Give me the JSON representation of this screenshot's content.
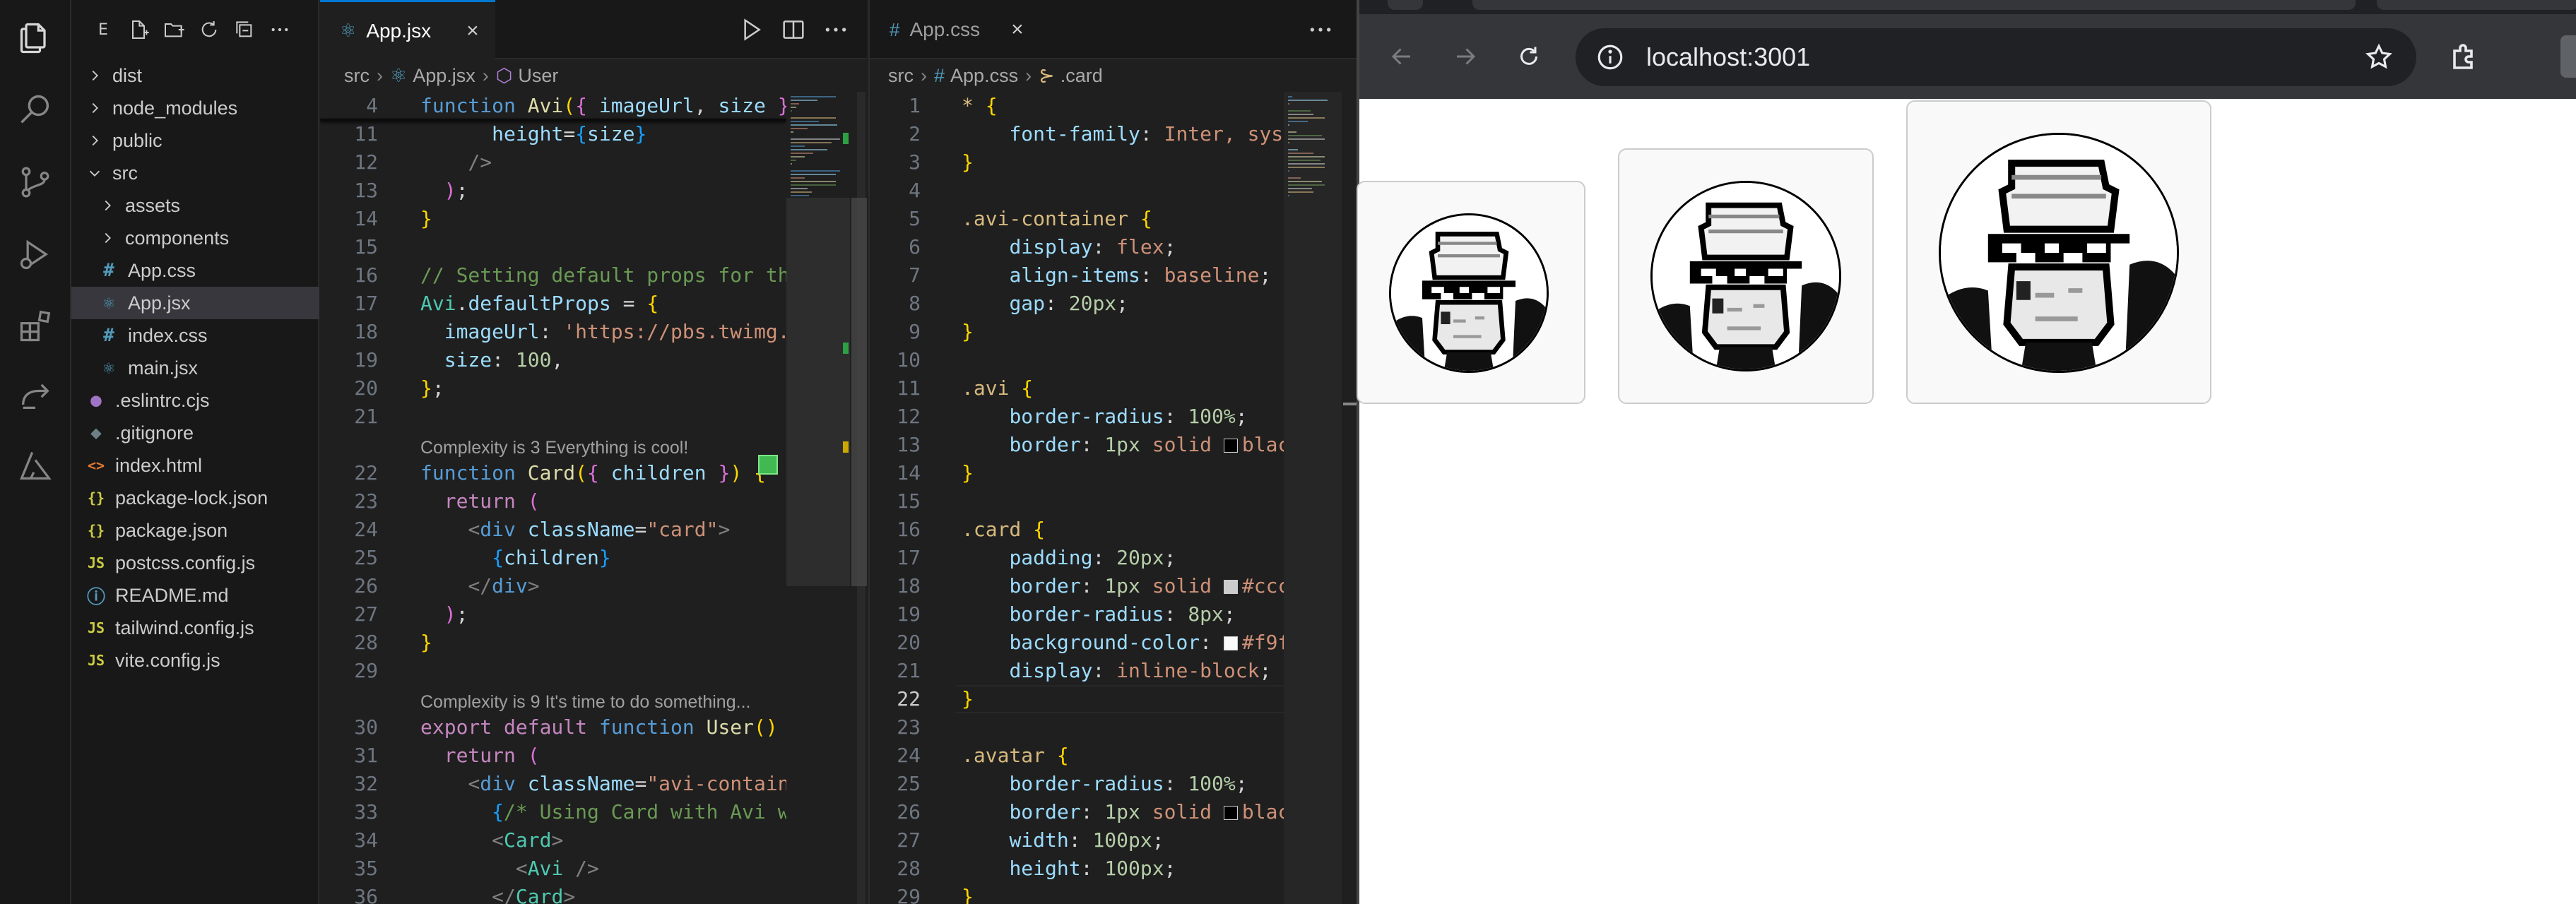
{
  "sidebar": {
    "header_label": "E",
    "tree": [
      {
        "label": "dist",
        "type": "folder",
        "expanded": false,
        "indent": 0
      },
      {
        "label": "node_modules",
        "type": "folder",
        "expanded": false,
        "indent": 0
      },
      {
        "label": "public",
        "type": "folder",
        "expanded": false,
        "indent": 0
      },
      {
        "label": "src",
        "type": "folder",
        "expanded": true,
        "indent": 0
      },
      {
        "label": "assets",
        "type": "folder",
        "expanded": false,
        "indent": 1
      },
      {
        "label": "components",
        "type": "folder",
        "expanded": false,
        "indent": 1
      },
      {
        "label": "App.css",
        "type": "css",
        "indent": 1
      },
      {
        "label": "App.jsx",
        "type": "jsx",
        "indent": 1,
        "selected": true
      },
      {
        "label": "index.css",
        "type": "css",
        "indent": 1
      },
      {
        "label": "main.jsx",
        "type": "jsx",
        "indent": 1
      },
      {
        "label": ".eslintrc.cjs",
        "type": "eslint",
        "indent": 0
      },
      {
        "label": ".gitignore",
        "type": "git",
        "indent": 0
      },
      {
        "label": "index.html",
        "type": "html",
        "indent": 0
      },
      {
        "label": "package-lock.json",
        "type": "json",
        "indent": 0
      },
      {
        "label": "package.json",
        "type": "json",
        "indent": 0
      },
      {
        "label": "postcss.config.js",
        "type": "js",
        "indent": 0
      },
      {
        "label": "README.md",
        "type": "info",
        "indent": 0
      },
      {
        "label": "tailwind.config.js",
        "type": "js",
        "indent": 0
      },
      {
        "label": "vite.config.js",
        "type": "js",
        "indent": 0
      }
    ]
  },
  "editor_left": {
    "tab_label": "App.jsx",
    "breadcrumb": [
      "src",
      "App.jsx",
      "User"
    ],
    "lines": [
      {
        "n": "4",
        "tokens": [
          [
            "t-kw",
            "function "
          ],
          [
            "t-fn",
            "Avi"
          ],
          [
            "t-br",
            "("
          ],
          [
            "t-br2",
            "{ "
          ],
          [
            "t-pm",
            "imageUrl"
          ],
          [
            "t-txt",
            ", "
          ],
          [
            "t-pm",
            "size "
          ],
          [
            "t-br2",
            "}"
          ],
          [
            "t-br",
            ")"
          ]
        ]
      },
      {
        "n": "11",
        "tokens": [
          [
            "t-txt",
            "      "
          ],
          [
            "t-pm",
            "height"
          ],
          [
            "t-txt",
            "="
          ],
          [
            "t-br3",
            "{"
          ],
          [
            "t-pm",
            "size"
          ],
          [
            "t-br3",
            "}"
          ]
        ]
      },
      {
        "n": "12",
        "tokens": [
          [
            "t-txt",
            "    "
          ],
          [
            "t-tag",
            "/>"
          ]
        ]
      },
      {
        "n": "13",
        "tokens": [
          [
            "t-txt",
            "  "
          ],
          [
            "t-br2",
            ")"
          ],
          [
            "t-txt",
            ";"
          ]
        ]
      },
      {
        "n": "14",
        "tokens": [
          [
            "t-br",
            "}"
          ]
        ]
      },
      {
        "n": "15",
        "tokens": []
      },
      {
        "n": "16",
        "tokens": [
          [
            "t-cm",
            "// Setting default props for the"
          ]
        ]
      },
      {
        "n": "17",
        "tokens": [
          [
            "t-comp",
            "Avi"
          ],
          [
            "t-txt",
            "."
          ],
          [
            "t-pm",
            "defaultProps"
          ],
          [
            "t-txt",
            " = "
          ],
          [
            "t-br",
            "{"
          ]
        ]
      },
      {
        "n": "18",
        "tokens": [
          [
            "t-txt",
            "  "
          ],
          [
            "t-pm",
            "imageUrl"
          ],
          [
            "t-txt",
            ": "
          ],
          [
            "t-str",
            "'https://pbs.twimg.co"
          ]
        ]
      },
      {
        "n": "19",
        "tokens": [
          [
            "t-txt",
            "  "
          ],
          [
            "t-pm",
            "size"
          ],
          [
            "t-txt",
            ": "
          ],
          [
            "t-num",
            "100"
          ],
          [
            "t-txt",
            ","
          ]
        ]
      },
      {
        "n": "20",
        "tokens": [
          [
            "t-br",
            "}"
          ],
          [
            "t-txt",
            ";"
          ]
        ]
      },
      {
        "n": "21",
        "tokens": []
      },
      {
        "lens": "Complexity is 3 Everything is cool!"
      },
      {
        "n": "22",
        "tokens": [
          [
            "t-kw",
            "function "
          ],
          [
            "t-fn",
            "Card"
          ],
          [
            "t-br",
            "("
          ],
          [
            "t-br2",
            "{ "
          ],
          [
            "t-pm",
            "children "
          ],
          [
            "t-br2",
            "}"
          ],
          [
            "t-br",
            ")"
          ],
          [
            "t-txt",
            " "
          ],
          [
            "t-br",
            "{"
          ]
        ]
      },
      {
        "n": "23",
        "tokens": [
          [
            "t-txt",
            "  "
          ],
          [
            "t-ctrl",
            "return "
          ],
          [
            "t-br2",
            "("
          ]
        ]
      },
      {
        "n": "24",
        "tokens": [
          [
            "t-txt",
            "    "
          ],
          [
            "t-tag",
            "<"
          ],
          [
            "t-kw",
            "div "
          ],
          [
            "t-pm",
            "className"
          ],
          [
            "t-txt",
            "="
          ],
          [
            "t-str",
            "\"card\""
          ],
          [
            "t-tag",
            ">"
          ]
        ]
      },
      {
        "n": "25",
        "tokens": [
          [
            "t-txt",
            "      "
          ],
          [
            "t-br3",
            "{"
          ],
          [
            "t-pm",
            "children"
          ],
          [
            "t-br3",
            "}"
          ]
        ]
      },
      {
        "n": "26",
        "tokens": [
          [
            "t-txt",
            "    "
          ],
          [
            "t-tag",
            "</"
          ],
          [
            "t-kw",
            "div"
          ],
          [
            "t-tag",
            ">"
          ]
        ]
      },
      {
        "n": "27",
        "tokens": [
          [
            "t-txt",
            "  "
          ],
          [
            "t-br2",
            ")"
          ],
          [
            "t-txt",
            ";"
          ]
        ]
      },
      {
        "n": "28",
        "tokens": [
          [
            "t-br",
            "}"
          ]
        ]
      },
      {
        "n": "29",
        "tokens": []
      },
      {
        "lens": "Complexity is 9 It's time to do something..."
      },
      {
        "n": "30",
        "tokens": [
          [
            "t-ctrl",
            "export default "
          ],
          [
            "t-kw",
            "function "
          ],
          [
            "t-fn",
            "User"
          ],
          [
            "t-br",
            "()"
          ],
          [
            "t-txt",
            " "
          ],
          [
            "t-br",
            "{"
          ]
        ]
      },
      {
        "n": "31",
        "tokens": [
          [
            "t-txt",
            "  "
          ],
          [
            "t-ctrl",
            "return "
          ],
          [
            "t-br2",
            "("
          ]
        ]
      },
      {
        "n": "32",
        "tokens": [
          [
            "t-txt",
            "    "
          ],
          [
            "t-tag",
            "<"
          ],
          [
            "t-kw",
            "div "
          ],
          [
            "t-pm",
            "className"
          ],
          [
            "t-txt",
            "="
          ],
          [
            "t-str",
            "\"avi-containe"
          ]
        ]
      },
      {
        "n": "33",
        "tokens": [
          [
            "t-txt",
            "      "
          ],
          [
            "t-br3",
            "{"
          ],
          [
            "t-cm",
            "/* Using Card with Avi wi"
          ]
        ]
      },
      {
        "n": "34",
        "tokens": [
          [
            "t-txt",
            "      "
          ],
          [
            "t-tag",
            "<"
          ],
          [
            "t-comp",
            "Card"
          ],
          [
            "t-tag",
            ">"
          ]
        ]
      },
      {
        "n": "35",
        "tokens": [
          [
            "t-txt",
            "        "
          ],
          [
            "t-tag",
            "<"
          ],
          [
            "t-comp",
            "Avi "
          ],
          [
            "t-tag",
            "/>"
          ]
        ]
      },
      {
        "n": "36",
        "tokens": [
          [
            "t-txt",
            "      "
          ],
          [
            "t-tag",
            "</"
          ],
          [
            "t-comp",
            "Card"
          ],
          [
            "t-tag",
            ">"
          ]
        ]
      }
    ]
  },
  "editor_right": {
    "tab_label": "App.css",
    "breadcrumb": [
      "src",
      "App.css",
      ".card"
    ],
    "current_line": "22",
    "lines": [
      {
        "n": "1",
        "tokens": [
          [
            "t-sel",
            "* "
          ],
          [
            "t-br",
            "{"
          ]
        ]
      },
      {
        "n": "2",
        "tokens": [
          [
            "t-txt",
            "    "
          ],
          [
            "t-prop",
            "font-family"
          ],
          [
            "t-txt",
            ": "
          ],
          [
            "t-val",
            "Inter, syst"
          ]
        ]
      },
      {
        "n": "3",
        "tokens": [
          [
            "t-br",
            "}"
          ]
        ]
      },
      {
        "n": "4",
        "tokens": []
      },
      {
        "n": "5",
        "tokens": [
          [
            "t-sel",
            ".avi-container "
          ],
          [
            "t-br",
            "{"
          ]
        ]
      },
      {
        "n": "6",
        "tokens": [
          [
            "t-txt",
            "    "
          ],
          [
            "t-prop",
            "display"
          ],
          [
            "t-txt",
            ": "
          ],
          [
            "t-val",
            "flex"
          ],
          [
            "t-txt",
            ";"
          ]
        ]
      },
      {
        "n": "7",
        "tokens": [
          [
            "t-txt",
            "    "
          ],
          [
            "t-prop",
            "align-items"
          ],
          [
            "t-txt",
            ": "
          ],
          [
            "t-val",
            "baseline"
          ],
          [
            "t-txt",
            ";"
          ]
        ]
      },
      {
        "n": "8",
        "tokens": [
          [
            "t-txt",
            "    "
          ],
          [
            "t-prop",
            "gap"
          ],
          [
            "t-txt",
            ": "
          ],
          [
            "t-num",
            "20px"
          ],
          [
            "t-txt",
            ";"
          ]
        ]
      },
      {
        "n": "9",
        "tokens": [
          [
            "t-br",
            "}"
          ]
        ]
      },
      {
        "n": "10",
        "tokens": []
      },
      {
        "n": "11",
        "tokens": [
          [
            "t-sel",
            ".avi "
          ],
          [
            "t-br",
            "{"
          ]
        ]
      },
      {
        "n": "12",
        "tokens": [
          [
            "t-txt",
            "    "
          ],
          [
            "t-prop",
            "border-radius"
          ],
          [
            "t-txt",
            ": "
          ],
          [
            "t-num",
            "100%"
          ],
          [
            "t-txt",
            ";"
          ]
        ]
      },
      {
        "n": "13",
        "tokens": [
          [
            "t-txt",
            "    "
          ],
          [
            "t-prop",
            "border"
          ],
          [
            "t-txt",
            ": "
          ],
          [
            "t-num",
            "1px "
          ],
          [
            "t-val",
            "solid "
          ],
          [
            "sw-black",
            ""
          ],
          [
            "t-val",
            "blac"
          ]
        ]
      },
      {
        "n": "14",
        "tokens": [
          [
            "t-br",
            "}"
          ]
        ]
      },
      {
        "n": "15",
        "tokens": []
      },
      {
        "n": "16",
        "tokens": [
          [
            "t-sel",
            ".card "
          ],
          [
            "t-br",
            "{"
          ]
        ]
      },
      {
        "n": "17",
        "tokens": [
          [
            "t-txt",
            "    "
          ],
          [
            "t-prop",
            "padding"
          ],
          [
            "t-txt",
            ": "
          ],
          [
            "t-num",
            "20px"
          ],
          [
            "t-txt",
            ";"
          ]
        ]
      },
      {
        "n": "18",
        "tokens": [
          [
            "t-txt",
            "    "
          ],
          [
            "t-prop",
            "border"
          ],
          [
            "t-txt",
            ": "
          ],
          [
            "t-num",
            "1px "
          ],
          [
            "t-val",
            "solid "
          ],
          [
            "sw-ccc",
            ""
          ],
          [
            "t-val",
            "#ccc"
          ]
        ]
      },
      {
        "n": "19",
        "tokens": [
          [
            "t-txt",
            "    "
          ],
          [
            "t-prop",
            "border-radius"
          ],
          [
            "t-txt",
            ": "
          ],
          [
            "t-num",
            "8px"
          ],
          [
            "t-txt",
            ";"
          ]
        ]
      },
      {
        "n": "20",
        "tokens": [
          [
            "t-txt",
            "    "
          ],
          [
            "t-prop",
            "background-color"
          ],
          [
            "t-txt",
            ": "
          ],
          [
            "sw-f9f",
            ""
          ],
          [
            "t-val",
            "#f9f"
          ]
        ]
      },
      {
        "n": "21",
        "tokens": [
          [
            "t-txt",
            "    "
          ],
          [
            "t-prop",
            "display"
          ],
          [
            "t-txt",
            ": "
          ],
          [
            "t-val",
            "inline-block"
          ],
          [
            "t-txt",
            ";"
          ]
        ]
      },
      {
        "n": "22",
        "tokens": [
          [
            "t-br",
            "}"
          ]
        ]
      },
      {
        "n": "23",
        "tokens": []
      },
      {
        "n": "24",
        "tokens": [
          [
            "t-sel",
            ".avatar "
          ],
          [
            "t-br",
            "{"
          ]
        ]
      },
      {
        "n": "25",
        "tokens": [
          [
            "t-txt",
            "    "
          ],
          [
            "t-prop",
            "border-radius"
          ],
          [
            "t-txt",
            ": "
          ],
          [
            "t-num",
            "100%"
          ],
          [
            "t-txt",
            ";"
          ]
        ]
      },
      {
        "n": "26",
        "tokens": [
          [
            "t-txt",
            "    "
          ],
          [
            "t-prop",
            "border"
          ],
          [
            "t-txt",
            ": "
          ],
          [
            "t-num",
            "1px "
          ],
          [
            "t-val",
            "solid "
          ],
          [
            "sw-black",
            ""
          ],
          [
            "t-val",
            "blac"
          ]
        ]
      },
      {
        "n": "27",
        "tokens": [
          [
            "t-txt",
            "    "
          ],
          [
            "t-prop",
            "width"
          ],
          [
            "t-txt",
            ": "
          ],
          [
            "t-num",
            "100px"
          ],
          [
            "t-txt",
            ";"
          ]
        ]
      },
      {
        "n": "28",
        "tokens": [
          [
            "t-txt",
            "    "
          ],
          [
            "t-prop",
            "height"
          ],
          [
            "t-txt",
            ": "
          ],
          [
            "t-num",
            "100px"
          ],
          [
            "t-txt",
            ";"
          ]
        ]
      },
      {
        "n": "29",
        "tokens": [
          [
            "t-br",
            "}"
          ]
        ]
      }
    ]
  },
  "browser": {
    "url": "localhost:3001"
  },
  "icons": {
    "explorer": "files-icon",
    "search": "search-icon",
    "scm": "source-control-icon",
    "debug": "run-debug-icon",
    "extensions": "extensions-icon",
    "remote": "remote-explorer-icon",
    "azure": "azure-icon"
  }
}
